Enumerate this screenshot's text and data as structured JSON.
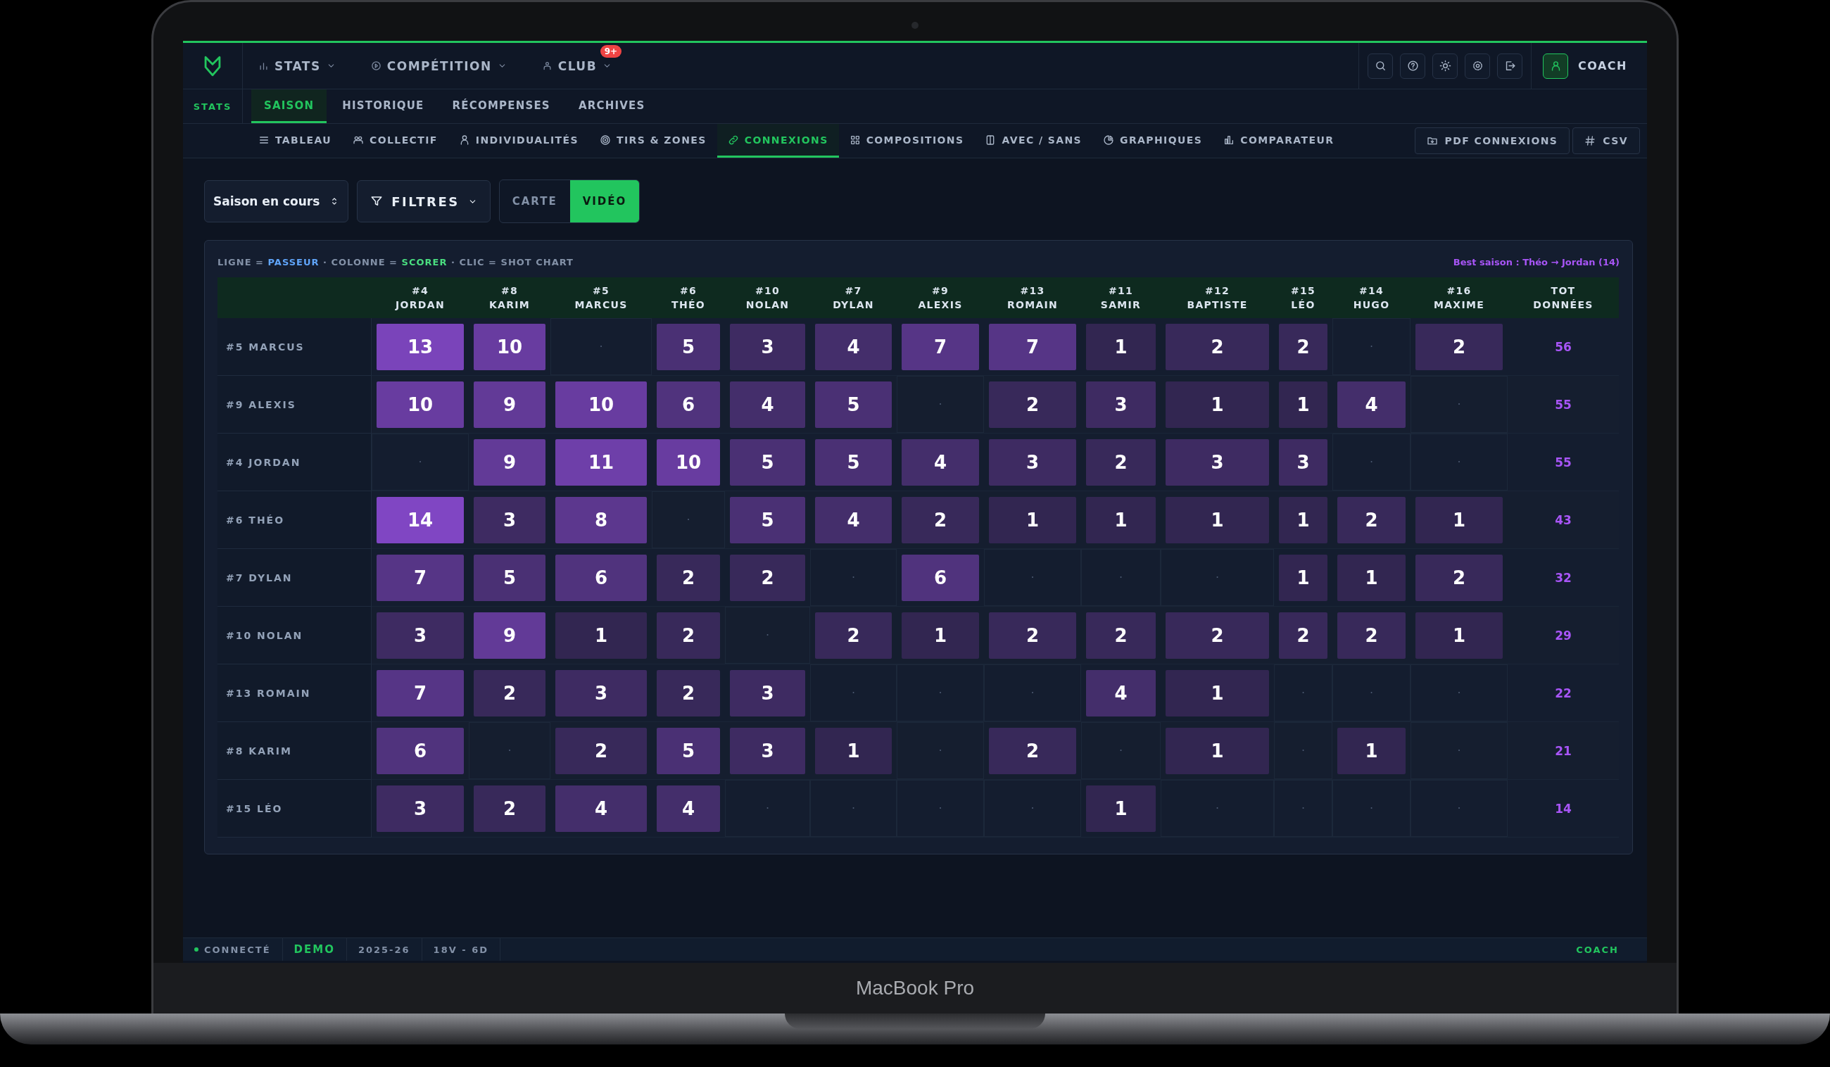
{
  "nav": {
    "menus": [
      {
        "label": "STATS"
      },
      {
        "label": "COMPÉTITION"
      },
      {
        "label": "CLUB",
        "badge": "9+"
      }
    ],
    "account": "COACH"
  },
  "subnav": {
    "section": "STATS",
    "tabs": [
      {
        "label": "SAISON",
        "selected": true
      },
      {
        "label": "HISTORIQUE",
        "selected": false
      },
      {
        "label": "RÉCOMPENSES",
        "selected": false
      },
      {
        "label": "ARCHIVES",
        "selected": false
      }
    ]
  },
  "views": {
    "tabs": [
      {
        "label": "TABLEAU",
        "selected": false
      },
      {
        "label": "COLLECTIF",
        "selected": false
      },
      {
        "label": "INDIVIDUALITÉS",
        "selected": false
      },
      {
        "label": "TIRS & ZONES",
        "selected": false
      },
      {
        "label": "CONNEXIONS",
        "selected": true
      },
      {
        "label": "COMPOSITIONS",
        "selected": false
      },
      {
        "label": "AVEC / SANS",
        "selected": false
      },
      {
        "label": "GRAPHIQUES",
        "selected": false
      },
      {
        "label": "COMPARATEUR",
        "selected": false
      }
    ],
    "exports": [
      "PDF CONNEXIONS",
      "CSV"
    ]
  },
  "toolbar": {
    "season": "Saison en cours",
    "filters": "FILTRES",
    "modes": [
      {
        "label": "CARTE",
        "selected": false
      },
      {
        "label": "VIDÉO",
        "selected": true
      }
    ]
  },
  "matrix": {
    "legend": [
      {
        "kind": "plain",
        "text": "LIGNE = "
      },
      {
        "kind": "row",
        "text": "PASSEUR"
      },
      {
        "kind": "plain",
        "text": " · COLONNE = "
      },
      {
        "kind": "column",
        "text": "SCORER"
      },
      {
        "kind": "plain",
        "text": " · CLIC = SHOT CHART"
      }
    ],
    "best": "Best saison : Théo → Jordan (14)",
    "columns": [
      {
        "number": "#4",
        "name": "JORDAN"
      },
      {
        "number": "#8",
        "name": "KARIM"
      },
      {
        "number": "#5",
        "name": "MARCUS"
      },
      {
        "number": "#6",
        "name": "THÉO"
      },
      {
        "number": "#10",
        "name": "NOLAN"
      },
      {
        "number": "#7",
        "name": "DYLAN"
      },
      {
        "number": "#9",
        "name": "ALEXIS"
      },
      {
        "number": "#13",
        "name": "ROMAIN"
      },
      {
        "number": "#11",
        "name": "SAMIR"
      },
      {
        "number": "#12",
        "name": "BAPTISTE"
      },
      {
        "number": "#15",
        "name": "LÉO"
      },
      {
        "number": "#14",
        "name": "HUGO"
      },
      {
        "number": "#16",
        "name": "MAXIME"
      },
      {
        "number": "TOT",
        "name": "DONNÉES"
      }
    ],
    "rows": [
      {
        "label": "#5 MARCUS",
        "cells": [
          "13",
          "10",
          "·",
          "5",
          "3",
          "4",
          "7",
          "7",
          "1",
          "2",
          "2",
          "·",
          "2"
        ],
        "total": "56"
      },
      {
        "label": "#9 ALEXIS",
        "cells": [
          "10",
          "9",
          "10",
          "6",
          "4",
          "5",
          "·",
          "2",
          "3",
          "1",
          "1",
          "4",
          "·"
        ],
        "total": "55"
      },
      {
        "label": "#4 JORDAN",
        "cells": [
          "·",
          "9",
          "11",
          "10",
          "5",
          "5",
          "4",
          "3",
          "2",
          "3",
          "3",
          "·",
          "·"
        ],
        "total": "55"
      },
      {
        "label": "#6 THÉO",
        "cells": [
          "14",
          "3",
          "8",
          "·",
          "5",
          "4",
          "2",
          "1",
          "1",
          "1",
          "1",
          "2",
          "1"
        ],
        "total": "43"
      },
      {
        "label": "#7 DYLAN",
        "cells": [
          "7",
          "5",
          "6",
          "2",
          "2",
          "·",
          "6",
          "·",
          "·",
          "·",
          "1",
          "1",
          "2"
        ],
        "total": "32"
      },
      {
        "label": "#10 NOLAN",
        "cells": [
          "3",
          "9",
          "1",
          "2",
          "·",
          "2",
          "1",
          "2",
          "2",
          "2",
          "2",
          "2",
          "1"
        ],
        "total": "29"
      },
      {
        "label": "#13 ROMAIN",
        "cells": [
          "7",
          "2",
          "3",
          "2",
          "3",
          "·",
          "·",
          "·",
          "4",
          "1",
          "·",
          "·",
          "·"
        ],
        "total": "22"
      },
      {
        "label": "#8 KARIM",
        "cells": [
          "6",
          "·",
          "2",
          "5",
          "3",
          "1",
          "·",
          "2",
          "·",
          "1",
          "·",
          "1",
          "·"
        ],
        "total": "21"
      },
      {
        "label": "#15 LÉO",
        "cells": [
          "3",
          "2",
          "4",
          "4",
          "·",
          "·",
          "·",
          "·",
          "1",
          "·",
          "·",
          "·",
          "·"
        ],
        "total": "14"
      }
    ]
  },
  "status": {
    "items": [
      {
        "kind": "connection",
        "text": "CONNECTÉ"
      },
      {
        "kind": "mode",
        "text": "DEMO"
      },
      {
        "kind": "plain",
        "text": "2025-26"
      },
      {
        "kind": "plain",
        "text": "18V - 6D"
      }
    ],
    "role": "COACH"
  },
  "device": {
    "model": "MacBook Pro"
  }
}
